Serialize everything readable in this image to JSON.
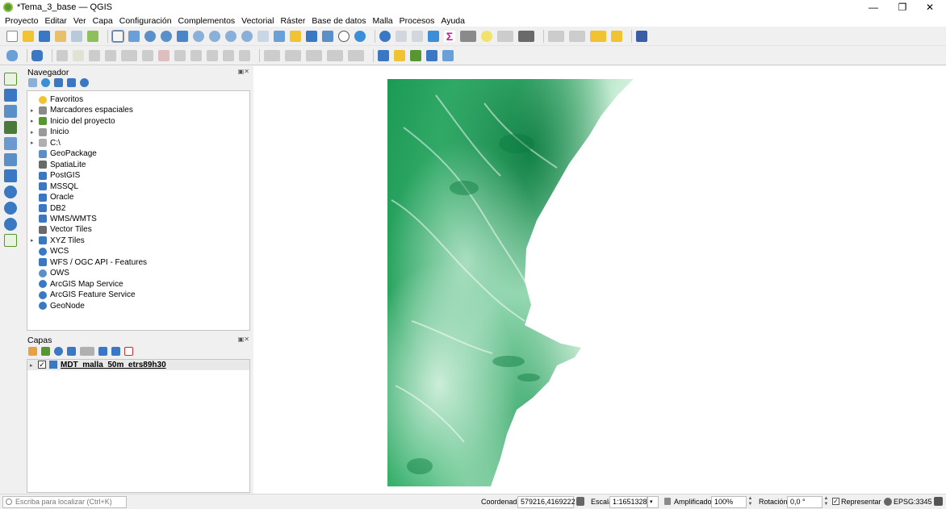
{
  "window": {
    "title": "*Tema_3_base — QGIS",
    "minimize": "—",
    "restore": "❐",
    "close": "✕"
  },
  "menu": [
    "Proyecto",
    "Editar",
    "Ver",
    "Capa",
    "Configuración",
    "Complementos",
    "Vectorial",
    "Ráster",
    "Base de datos",
    "Malla",
    "Procesos",
    "Ayuda"
  ],
  "icons": {
    "colors": {
      "qgis_green": "#589632",
      "toolbar_blue": "#3a78c3",
      "toolbar_yellow": "#f1c232",
      "toolbar_grey": "#8a8a8a",
      "dem_dark": "#0a7a3e",
      "dem_light": "#f2fbf4"
    }
  },
  "navigator": {
    "title": "Navegador",
    "items": [
      {
        "label": "Favoritos",
        "icon": "star-icon",
        "expandable": false
      },
      {
        "label": "Marcadores espaciales",
        "icon": "bookmarks-icon",
        "expandable": true
      },
      {
        "label": "Inicio del proyecto",
        "icon": "project-home-icon",
        "expandable": true
      },
      {
        "label": "Inicio",
        "icon": "home-folder-icon",
        "expandable": true
      },
      {
        "label": "C:\\",
        "icon": "drive-icon",
        "expandable": true
      },
      {
        "label": "GeoPackage",
        "icon": "geopackage-icon",
        "expandable": false
      },
      {
        "label": "SpatiaLite",
        "icon": "spatialite-icon",
        "expandable": false
      },
      {
        "label": "PostGIS",
        "icon": "postgis-icon",
        "expandable": false
      },
      {
        "label": "MSSQL",
        "icon": "mssql-icon",
        "expandable": false
      },
      {
        "label": "Oracle",
        "icon": "oracle-icon",
        "expandable": false
      },
      {
        "label": "DB2",
        "icon": "db2-icon",
        "expandable": false
      },
      {
        "label": "WMS/WMTS",
        "icon": "wms-icon",
        "expandable": false
      },
      {
        "label": "Vector Tiles",
        "icon": "vector-tiles-icon",
        "expandable": false
      },
      {
        "label": "XYZ Tiles",
        "icon": "xyz-tiles-icon",
        "expandable": true
      },
      {
        "label": "WCS",
        "icon": "wcs-icon",
        "expandable": false
      },
      {
        "label": "WFS / OGC API - Features",
        "icon": "wfs-icon",
        "expandable": false
      },
      {
        "label": "OWS",
        "icon": "ows-icon",
        "expandable": false
      },
      {
        "label": "ArcGIS Map Service",
        "icon": "arcgis-map-icon",
        "expandable": false
      },
      {
        "label": "ArcGIS Feature Service",
        "icon": "arcgis-feature-icon",
        "expandable": false
      },
      {
        "label": "GeoNode",
        "icon": "geonode-icon",
        "expandable": false
      }
    ]
  },
  "layers": {
    "title": "Capas",
    "items": [
      {
        "label": "MDT_malla_50m_etrs89h30",
        "checked": true,
        "icon": "raster-layer-icon"
      }
    ]
  },
  "status": {
    "locator_placeholder": "Escriba para localizar (Ctrl+K)",
    "coord_label": "Coordenada",
    "coord_value": "579216,4169222",
    "scale_label": "Escala",
    "scale_value": "1:1651328",
    "magnifier_label": "Amplificador",
    "magnifier_value": "100%",
    "rotation_label": "Rotación",
    "rotation_value": "0,0 °",
    "render_label": "Representar",
    "render_checked": true,
    "crs": "EPSG:3345"
  }
}
